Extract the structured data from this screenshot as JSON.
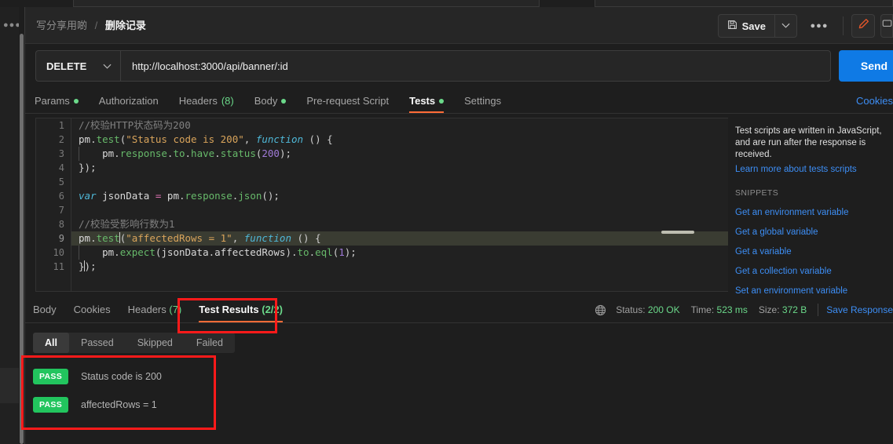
{
  "header": {
    "breadcrumb_parent": "写分享用啲",
    "breadcrumb_separator": "/",
    "breadcrumb_current": "删除记录",
    "save_label": "Save",
    "save_caret_icon": "chevron-down-icon",
    "save_icon": "floppy-disk-icon",
    "more_label": "●●●",
    "pencil_icon": "pencil-icon",
    "accent_orange": "#ff6c37"
  },
  "request": {
    "method": "DELETE",
    "method_caret_icon": "chevron-down-icon",
    "url": "http://localhost:3000/api/banner/:id",
    "send_label": "Send",
    "send_color": "#0f7ae5"
  },
  "request_tabs": {
    "items": [
      {
        "label": "Params",
        "dot": true,
        "count": "",
        "active": false
      },
      {
        "label": "Authorization",
        "dot": false,
        "count": "",
        "active": false
      },
      {
        "label": "Headers",
        "dot": false,
        "count": "(8)",
        "active": false
      },
      {
        "label": "Body",
        "dot": true,
        "count": "",
        "active": false
      },
      {
        "label": "Pre-request Script",
        "dot": false,
        "count": "",
        "active": false
      },
      {
        "label": "Tests",
        "dot": true,
        "count": "",
        "active": true
      },
      {
        "label": "Settings",
        "dot": false,
        "count": "",
        "active": false
      }
    ],
    "cookies_link": "Cookies"
  },
  "editor": {
    "lines": [
      {
        "n": "1",
        "highlight": false
      },
      {
        "n": "2",
        "highlight": false
      },
      {
        "n": "3",
        "highlight": false
      },
      {
        "n": "4",
        "highlight": false
      },
      {
        "n": "5",
        "highlight": false
      },
      {
        "n": "6",
        "highlight": false
      },
      {
        "n": "7",
        "highlight": false
      },
      {
        "n": "8",
        "highlight": false
      },
      {
        "n": "9",
        "highlight": true
      },
      {
        "n": "10",
        "highlight": false
      },
      {
        "n": "11",
        "highlight": false
      }
    ],
    "source": [
      "//校验HTTP状态码为200",
      "pm.test(\"Status code is 200\", function () {",
      "    pm.response.to.have.status(200);",
      "});",
      "",
      "var jsonData = pm.response.json();",
      "",
      "//校验受影响行数为1",
      "pm.test(\"affectedRows = 1\", function () {",
      "    pm.expect(jsonData.affectedRows).to.eql(1);",
      "});"
    ]
  },
  "snippets": {
    "description": "Test scripts are written in JavaScript, and are run after the response is received.",
    "learn_more": "Learn more about tests scripts",
    "title": "SNIPPETS",
    "items": [
      "Get an environment variable",
      "Get a global variable",
      "Get a variable",
      "Get a collection variable",
      "Set an environment variable"
    ]
  },
  "response_tabs": {
    "items": [
      {
        "label": "Body",
        "count": "",
        "active": false
      },
      {
        "label": "Cookies",
        "count": "",
        "active": false
      },
      {
        "label": "Headers",
        "count": "(7)",
        "active": false
      },
      {
        "label": "Test Results",
        "count": "(2/2)",
        "active": true
      }
    ]
  },
  "status": {
    "globe_icon": "globe-icon",
    "status_label": "Status:",
    "status_value": "200 OK",
    "time_label": "Time:",
    "time_value": "523 ms",
    "size_label": "Size:",
    "size_value": "372 B",
    "save_response": "Save Response"
  },
  "test_filters": [
    {
      "label": "All",
      "active": true
    },
    {
      "label": "Passed",
      "active": false
    },
    {
      "label": "Skipped",
      "active": false
    },
    {
      "label": "Failed",
      "active": false
    }
  ],
  "test_results": [
    {
      "badge": "PASS",
      "name": "Status code is 200"
    },
    {
      "badge": "PASS",
      "name": "affectedRows = 1"
    }
  ],
  "annotation_color": "#ff1a1a"
}
